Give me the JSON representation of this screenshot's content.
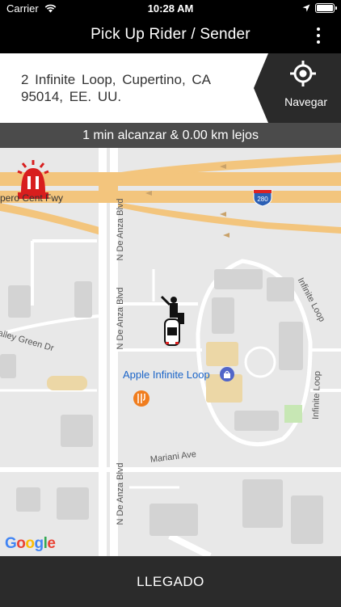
{
  "status_bar": {
    "carrier": "Carrier",
    "time": "10:28 AM"
  },
  "header": {
    "title": "Pick Up Rider / Sender",
    "menu_icon": "more-vertical-icon"
  },
  "address": {
    "line1": "2 Infinite Loop,  Cupertino,  CA",
    "line2": "95014,  EE. UU."
  },
  "navigate": {
    "label": "Navegar",
    "icon": "crosshair-icon"
  },
  "eta": {
    "text": "1 min alcanzar & 0.00 km lejos"
  },
  "map": {
    "freeway_label": "pero Cent  Fwy",
    "interstate_shield": "280",
    "labels": {
      "de_anza_top": "N De Anza Blvd",
      "de_anza_mid": "N De Anza Blvd",
      "de_anza_bottom": "N De Anza Blvd",
      "valley_green": "alley Green Dr",
      "infinite_loop_1": "Infinite Loop",
      "infinite_loop_2": "Infinite Loop",
      "mariani": "Mariani Ave"
    },
    "poi": "Apple Infinite Loop",
    "attribution": "Google",
    "colors": {
      "freeway": "#f3c57d",
      "background": "#e8e8e8",
      "poi_blue": "#1a64c8",
      "siren_red": "#d81e1e",
      "restaurant_orange": "#f07d1e"
    }
  },
  "footer": {
    "button_label": "LLEGADO"
  }
}
